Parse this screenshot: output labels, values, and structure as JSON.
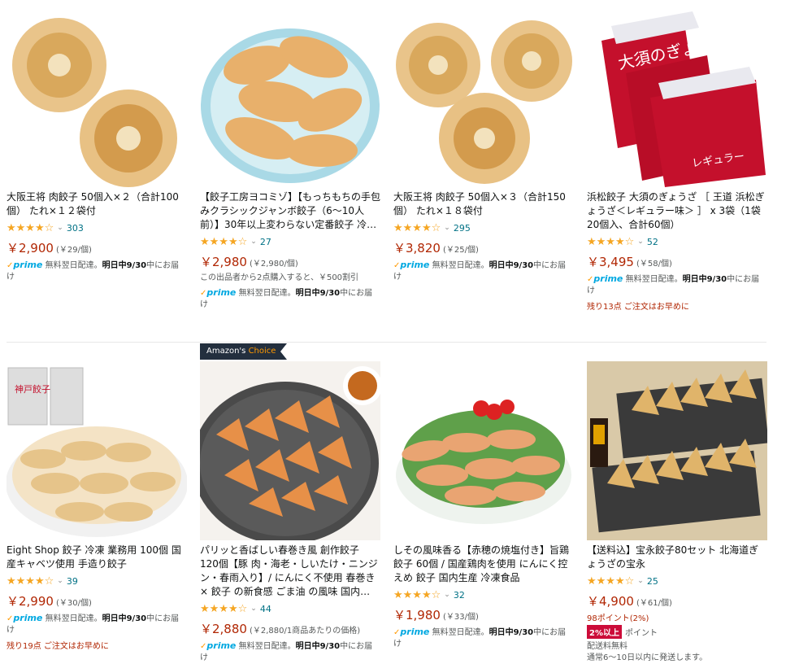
{
  "badges": {
    "amazons": "Amazon's ",
    "choice": "Choice"
  },
  "products": [
    {
      "title": "大阪王将 肉餃子 50個入×２（合計100個） たれ×１２袋付",
      "stars": "★★★★☆",
      "rating_value": 4.0,
      "rating_count": "303",
      "price": "￥2,900",
      "unit_price": "(￥29/個)",
      "prime_label": "prime",
      "shipping": "無料翌日配達。",
      "delivery_date": "明日中9/30",
      "delivery_tail": "中にお届け"
    },
    {
      "title": "【餃子工房ヨコミゾ】【もっちもちの手包みクラシックジャンボ餃子（6～10人前）】30年以上変わらない定番餃子 冷凍 お取り寄せ 敬老の日グルメ おつま…",
      "stars": "★★★★☆",
      "rating_value": 4.5,
      "rating_count": "27",
      "price": "￥2,980",
      "unit_price": "(￥2,980/個)",
      "promo": "この出品者から2点購入すると、￥500割引",
      "prime_label": "prime",
      "shipping": "無料翌日配達。",
      "delivery_date": "明日中9/30",
      "delivery_tail": "中にお届け"
    },
    {
      "title": "大阪王将 肉餃子 50個入×３（合計150個） たれ×１８袋付",
      "stars": "★★★★☆",
      "rating_value": 4.0,
      "rating_count": "295",
      "price": "￥3,820",
      "unit_price": "(￥25/個)",
      "prime_label": "prime",
      "shipping": "無料翌日配達。",
      "delivery_date": "明日中9/30",
      "delivery_tail": "中にお届け"
    },
    {
      "title": "浜松餃子 大須のぎょうざ ［ 王道 浜松ぎょうざ＜レギュラー味＞ ］ x 3袋（1袋20個入、合計60個）",
      "stars": "★★★★☆",
      "rating_value": 4.0,
      "rating_count": "52",
      "price": "￥3,495",
      "unit_price": "(￥58/個)",
      "prime_label": "prime",
      "shipping": "無料翌日配達。",
      "delivery_date": "明日中9/30",
      "delivery_tail": "中にお届け",
      "stock": "残り13点 ご注文はお早めに",
      "package_text": [
        "大須のぎょうざ",
        "レギュラー"
      ]
    },
    {
      "title": "Eight Shop 餃子 冷凍 業務用 100個 国産キャベツ使用 手造り餃子",
      "stars": "★★★★☆",
      "rating_value": 4.0,
      "rating_count": "39",
      "price": "￥2,990",
      "unit_price": "(￥30/個)",
      "prime_label": "prime",
      "shipping": "無料翌日配達。",
      "delivery_date": "明日中9/30",
      "delivery_tail": "中にお届け",
      "stock": "残り19点 ご注文はお早めに",
      "package_text": [
        "神戸餃子"
      ]
    },
    {
      "title": "パリッと香ばしい春巻き風 創作餃子 120個【豚 肉・海老・しいたけ・ニンジン・春雨入り】/ にんにく不使用 春巻き × 餃子 の新食感 ごま油 の風味 国内…",
      "stars": "★★★★☆",
      "rating_value": 4.0,
      "rating_count": "44",
      "price": "￥2,880",
      "unit_price": "(￥2,880/1商品あたりの価格)",
      "prime_label": "prime",
      "shipping": "無料翌日配達。",
      "delivery_date": "明日中9/30",
      "delivery_tail": "中にお届け"
    },
    {
      "title": "しその風味香る【赤穂の焼塩付き】旨鶏 餃子 60個 / 国産鶏肉を使用 にんにく控えめ 餃子 国内生産 冷凍食品",
      "stars": "★★★★☆",
      "rating_value": 4.5,
      "rating_count": "32",
      "price": "￥1,980",
      "unit_price": "(￥33/個)",
      "prime_label": "prime",
      "shipping": "無料翌日配達。",
      "delivery_date": "明日中9/30",
      "delivery_tail": "中にお届け"
    },
    {
      "title": "【送料込】宝永餃子80セット 北海道ぎょうざの宝永",
      "stars": "★★★★☆",
      "rating_value": 4.5,
      "rating_count": "25",
      "price": "￥4,900",
      "unit_price": "(￥61/個)",
      "points_text": "98ポイント(2%)",
      "points_badge": "2%以上",
      "points_label": "ポイント",
      "free_ship": "配送料無料",
      "ship_window": "通常6～10日以内に発送します。"
    }
  ],
  "colors": {
    "price": "#b12704",
    "star": "#f5a623",
    "link": "#007185",
    "prime": "#00a8e1",
    "badge_bg": "#232f3e",
    "badge_accent": "#ff9900"
  }
}
